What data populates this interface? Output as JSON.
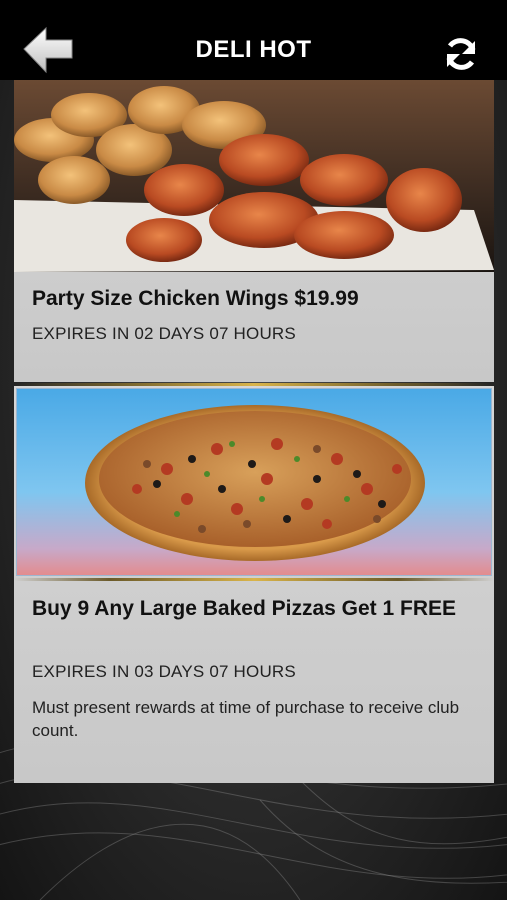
{
  "header": {
    "title": "DELI HOT",
    "back_icon": "back-arrow-icon",
    "refresh_icon": "refresh-icon"
  },
  "deals": [
    {
      "title": "Party Size Chicken Wings $19.99",
      "expires": "EXPIRES IN 02 DAYS 07 HOURS",
      "image": "chicken-wings-image"
    },
    {
      "title": "Buy 9 Any Large Baked Pizzas Get 1 FREE",
      "expires": "EXPIRES IN 03 DAYS 07 HOURS",
      "description": "Must present rewards at time of purchase to receive club count.",
      "image": "pizza-image"
    }
  ],
  "colors": {
    "header_bg": "#000000",
    "card_bg": "#d0d0d0",
    "accent_gold": "#d9b44a"
  }
}
